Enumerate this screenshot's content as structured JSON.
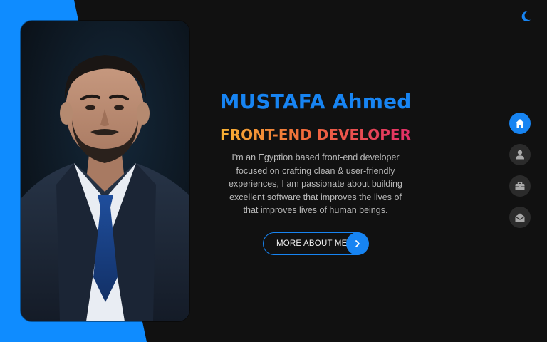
{
  "hero": {
    "name": "MUSTAFA Ahmed",
    "role": "FRONT-END DEVELOPER",
    "intro": "I'm an Egyption based front-end developer focused on crafting clean & user-friendly experiences, I am passionate about building excellent software that improves the lives of that improves lives of human beings.",
    "cta_label": "MORE ABOUT ME"
  },
  "nav": {
    "items": [
      {
        "icon": "home-icon",
        "active": true
      },
      {
        "icon": "user-icon",
        "active": false
      },
      {
        "icon": "briefcase-icon",
        "active": false
      },
      {
        "icon": "envelope-open-icon",
        "active": false
      }
    ]
  },
  "theme": {
    "toggle_icon": "moon-icon"
  },
  "colors": {
    "accent": "#1784f2",
    "background": "#111111",
    "side_panel": "#0f8cff",
    "gradient_start": "#f7b733",
    "gradient_end": "#e12b6b"
  }
}
